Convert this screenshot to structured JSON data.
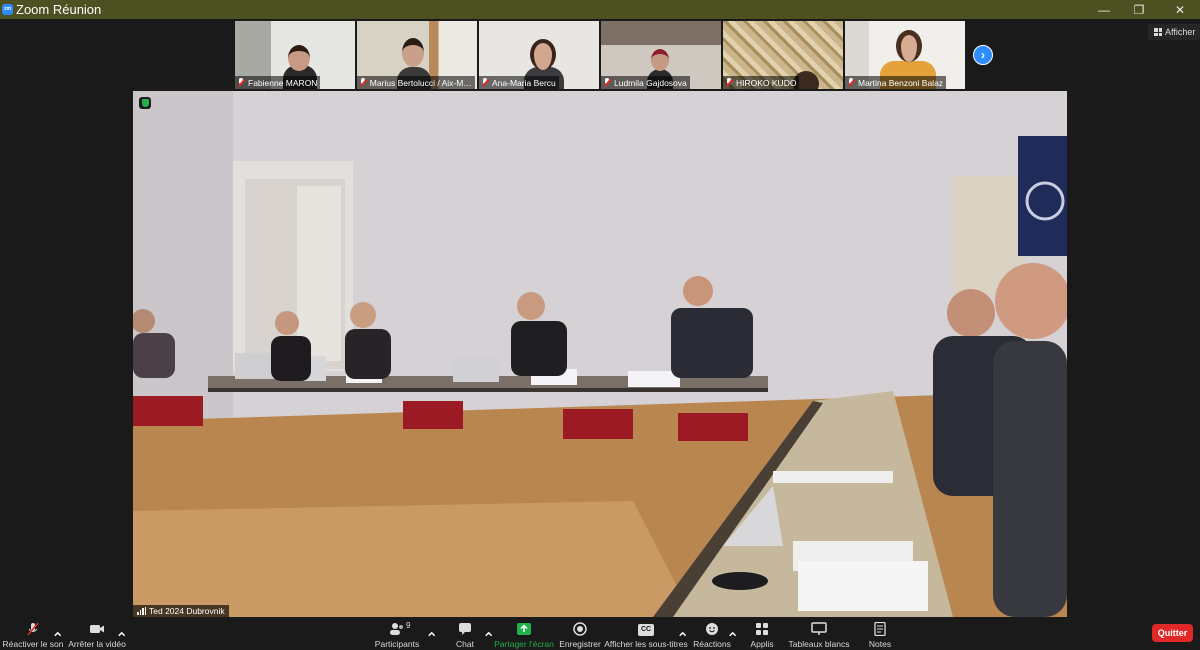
{
  "window": {
    "title": "Zoom Réunion",
    "logo_text": "zm"
  },
  "header": {
    "view_label": "Afficher"
  },
  "participants_strip": [
    {
      "name": "Fabienne MARON",
      "muted": true
    },
    {
      "name": "Marius Bertolucci / Aix-Ma...",
      "muted": true
    },
    {
      "name": "Ana-Maria Bercu",
      "muted": true
    },
    {
      "name": "Ludmila Gajdosova",
      "muted": true
    },
    {
      "name": "HIROKO KUDO",
      "muted": true
    },
    {
      "name": "Martina Benzoni Balaz",
      "muted": true
    }
  ],
  "main_video": {
    "speaker_name": "Ted 2024 Dubrovnik",
    "encrypted_icon": "shield-check-icon"
  },
  "toolbar": {
    "unmute_label": "Réactiver le son",
    "stop_video_label": "Arrêter la vidéo",
    "participants_label": "Participants",
    "participants_count": "9",
    "chat_label": "Chat",
    "share_label": "Partager l'écran",
    "record_label": "Enregistrer",
    "captions_label": "Afficher les sous-titres",
    "captions_badge": "CC",
    "reactions_label": "Réactions",
    "apps_label": "Applis",
    "whiteboards_label": "Tableaux blancs",
    "notes_label": "Notes",
    "quit_label": "Quitter"
  },
  "colors": {
    "titlebar": "#4d5122",
    "accent_blue": "#2d8cff",
    "share_green": "#23b14d",
    "quit_red": "#e02828"
  }
}
